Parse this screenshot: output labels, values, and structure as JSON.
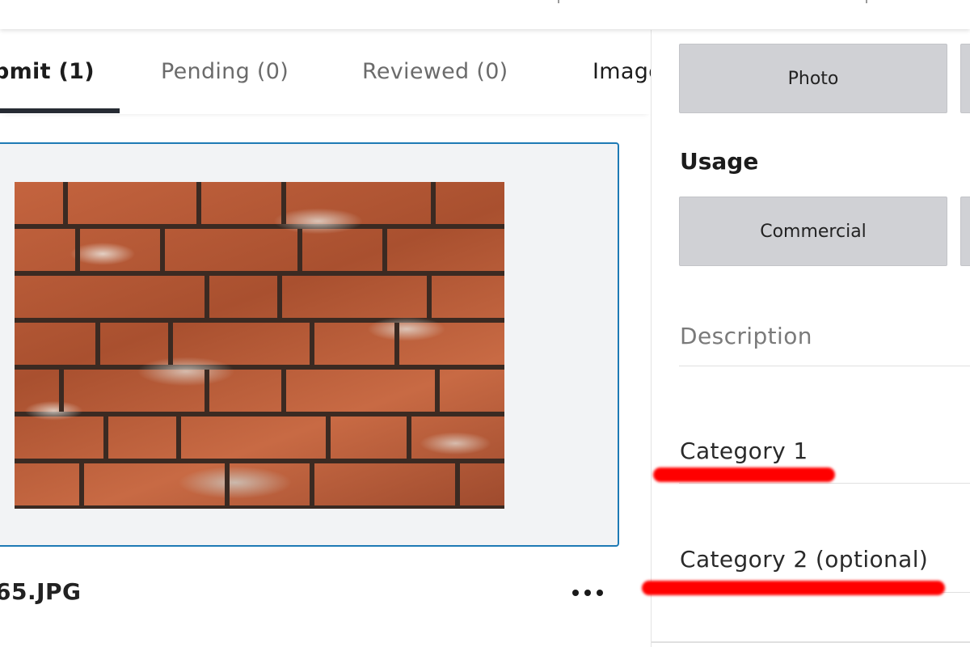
{
  "tabs": [
    {
      "label": "bmit (1)",
      "active": true
    },
    {
      "label": "Pending (0)",
      "active": false
    },
    {
      "label": "Reviewed (0)",
      "active": false
    },
    {
      "label": "Image",
      "active": false
    }
  ],
  "file": {
    "name": "65.JPG",
    "more_label": "More options",
    "thumbnail": "brick-wall-photo"
  },
  "content_type": {
    "selected_label": "Photo"
  },
  "usage": {
    "title": "Usage",
    "selected_label": "Commercial"
  },
  "fields": {
    "description_placeholder": "Description",
    "category1_label": "Category 1",
    "category2_label": "Category 2 (optional)"
  },
  "colors": {
    "accent_border": "#1e7ab5",
    "option_button_bg": "#d0d1d5",
    "annotation_red": "#ff0000"
  }
}
